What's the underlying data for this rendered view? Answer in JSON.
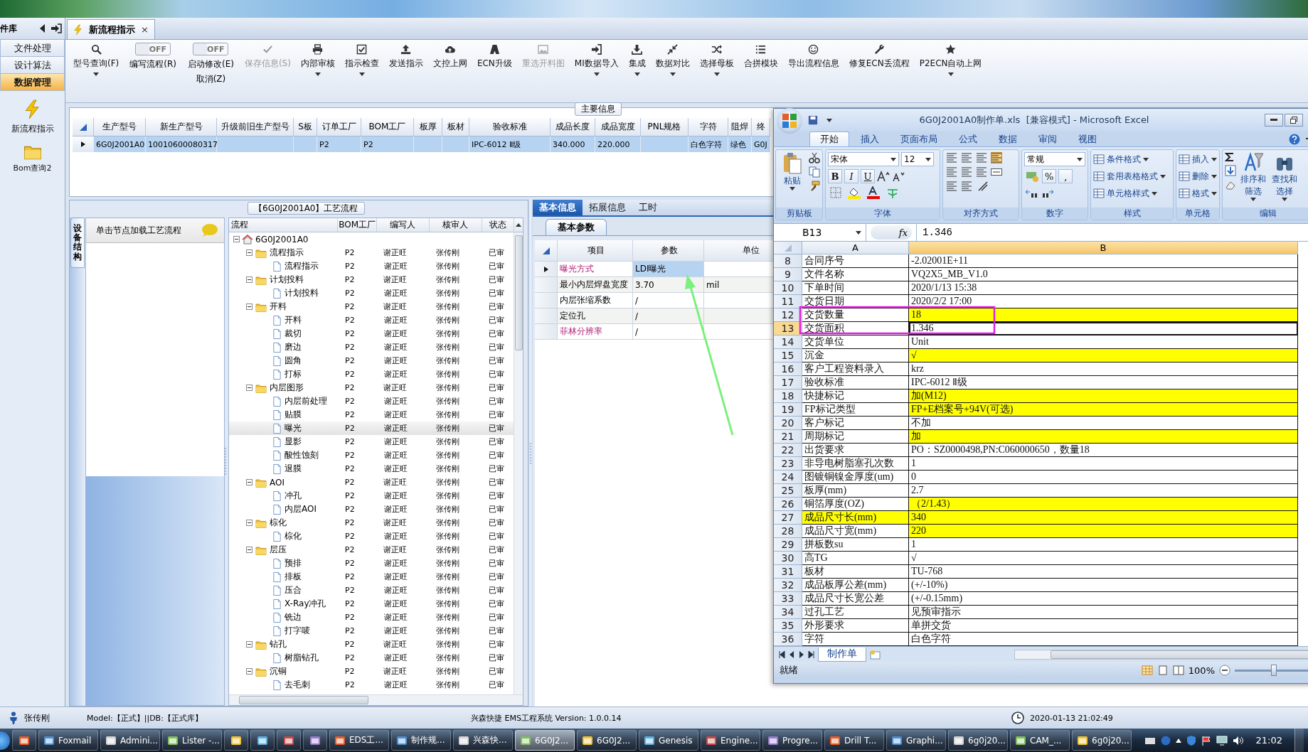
{
  "nav": {
    "title": "件库",
    "items": [
      {
        "label": "文件处理",
        "selected": false
      },
      {
        "label": "设计算法",
        "selected": false
      },
      {
        "label": "数据管理",
        "selected": true
      }
    ],
    "shortcuts": [
      {
        "kind": "bolt",
        "label": "新流程指示"
      },
      {
        "kind": "folder",
        "label": "Bom查询2"
      }
    ]
  },
  "document_tab": {
    "title": "新流程指示",
    "close": "×",
    "selected": true
  },
  "toolbar": [
    {
      "kind": "button",
      "label": "型号查询(F)",
      "disabled": false,
      "dropdown": true
    },
    {
      "kind": "toggle",
      "label": "编写流程(R)",
      "switch_text": "OFF",
      "on": false
    },
    {
      "kind": "toggle",
      "label": "启动修改(E)",
      "sublabel": "取消(Z)",
      "switch_text": "OFF",
      "on": false
    },
    {
      "kind": "button",
      "label": "保存信息(S)",
      "disabled": true,
      "dropdown": false
    },
    {
      "kind": "button",
      "label": "内部审核",
      "disabled": false,
      "dropdown": true
    },
    {
      "kind": "button",
      "label": "指示检查",
      "disabled": false,
      "dropdown": true
    },
    {
      "kind": "button",
      "label": "发送指示",
      "disabled": false,
      "dropdown": false
    },
    {
      "kind": "button",
      "label": "文控上网",
      "disabled": false,
      "dropdown": false
    },
    {
      "kind": "button",
      "label": "ECN升级",
      "disabled": false,
      "dropdown": false
    },
    {
      "kind": "button",
      "label": "重选开料图",
      "disabled": true,
      "dropdown": false
    },
    {
      "kind": "button",
      "label": "MI数据导入",
      "disabled": false,
      "dropdown": true
    },
    {
      "kind": "button",
      "label": "集成",
      "disabled": false,
      "dropdown": true
    },
    {
      "kind": "button",
      "label": "数据对比",
      "disabled": false,
      "dropdown": true
    },
    {
      "kind": "button",
      "label": "选择母板",
      "disabled": false,
      "dropdown": true
    },
    {
      "kind": "button",
      "label": "合拼模块",
      "disabled": false,
      "dropdown": false
    },
    {
      "kind": "button",
      "label": "导出流程信息",
      "disabled": false,
      "dropdown": false
    },
    {
      "kind": "button",
      "label": "修复ECN丢流程",
      "disabled": false,
      "dropdown": false
    },
    {
      "kind": "button",
      "label": "P2ECN自动上网",
      "disabled": false,
      "dropdown": true
    }
  ],
  "main_info": {
    "title": "主要信息",
    "columns": [
      "生产型号",
      "新生产型号",
      "升级前旧生产型号",
      "S板",
      "订单工厂",
      "BOM工厂",
      "板厚",
      "板材",
      "验收标准",
      "成品长度",
      "成品宽度",
      "PNL规格",
      "字符",
      "阻焊",
      "终"
    ],
    "rows": [
      {
        "selected": true,
        "cells": [
          "6G0J2001A0",
          "10010600080317",
          null,
          null,
          "P2",
          "P2",
          null,
          null,
          "IPC-6012 Ⅱ级",
          "340.000",
          "220.000",
          null,
          "白色字符",
          "绿色",
          "G0J"
        ]
      }
    ]
  },
  "process_panel": {
    "title": "【6G0J2001A0】工艺流程",
    "side_tab": "设备结构",
    "hint": "单击节点加载工艺流程",
    "columns": [
      "流程",
      "BOM工厂",
      "编写人",
      "核审人",
      "状态"
    ],
    "tree": [
      {
        "kind": "root",
        "name": "6G0J2001A0",
        "selected": false,
        "expanded": true,
        "children": [
          {
            "kind": "folder",
            "name": "流程指示",
            "bom": "P2",
            "writer": "谢正旺",
            "reviewer": "张传刚",
            "status": "已审",
            "selected": false,
            "expanded": true,
            "children": [
              {
                "kind": "step",
                "name": "流程指示",
                "bom": "P2",
                "writer": "谢正旺",
                "reviewer": "张传刚",
                "status": "已审",
                "selected": false
              }
            ]
          },
          {
            "kind": "folder",
            "name": "计划投料",
            "bom": "P2",
            "writer": "谢正旺",
            "reviewer": "张传刚",
            "status": "已审",
            "selected": false,
            "expanded": true,
            "children": [
              {
                "kind": "step",
                "name": "计划投料",
                "bom": "P2",
                "writer": "谢正旺",
                "reviewer": "张传刚",
                "status": "已审",
                "selected": false
              }
            ]
          },
          {
            "kind": "folder",
            "name": "开料",
            "bom": "P2",
            "writer": "谢正旺",
            "reviewer": "张传刚",
            "status": "已审",
            "selected": false,
            "expanded": true,
            "children": [
              {
                "kind": "step",
                "name": "开料",
                "bom": "P2",
                "writer": "谢正旺",
                "reviewer": "张传刚",
                "status": "已审",
                "selected": false
              },
              {
                "kind": "step",
                "name": "裁切",
                "bom": "P2",
                "writer": "谢正旺",
                "reviewer": "张传刚",
                "status": "已审",
                "selected": false
              },
              {
                "kind": "step",
                "name": "磨边",
                "bom": "P2",
                "writer": "谢正旺",
                "reviewer": "张传刚",
                "status": "已审",
                "selected": false
              },
              {
                "kind": "step",
                "name": "圆角",
                "bom": "P2",
                "writer": "谢正旺",
                "reviewer": "张传刚",
                "status": "已审",
                "selected": false
              },
              {
                "kind": "step",
                "name": "打标",
                "bom": "P2",
                "writer": "谢正旺",
                "reviewer": "张传刚",
                "status": "已审",
                "selected": false
              }
            ]
          },
          {
            "kind": "folder",
            "name": "内层图形",
            "bom": "P2",
            "writer": "谢正旺",
            "reviewer": "张传刚",
            "status": "已审",
            "selected": false,
            "expanded": true,
            "children": [
              {
                "kind": "step",
                "name": "内层前处理",
                "bom": "P2",
                "writer": "谢正旺",
                "reviewer": "张传刚",
                "status": "已审",
                "selected": false
              },
              {
                "kind": "step",
                "name": "贴膜",
                "bom": "P2",
                "writer": "谢正旺",
                "reviewer": "张传刚",
                "status": "已审",
                "selected": false
              },
              {
                "kind": "step",
                "name": "曝光",
                "bom": "P2",
                "writer": "谢正旺",
                "reviewer": "张传刚",
                "status": "已审",
                "selected": true
              },
              {
                "kind": "step",
                "name": "显影",
                "bom": "P2",
                "writer": "谢正旺",
                "reviewer": "张传刚",
                "status": "已审",
                "selected": false
              },
              {
                "kind": "step",
                "name": "酸性蚀刻",
                "bom": "P2",
                "writer": "谢正旺",
                "reviewer": "张传刚",
                "status": "已审",
                "selected": false
              },
              {
                "kind": "step",
                "name": "退膜",
                "bom": "P2",
                "writer": "谢正旺",
                "reviewer": "张传刚",
                "status": "已审",
                "selected": false
              }
            ]
          },
          {
            "kind": "folder",
            "name": "AOI",
            "bom": "P2",
            "writer": "谢正旺",
            "reviewer": "张传刚",
            "status": "已审",
            "selected": false,
            "expanded": true,
            "children": [
              {
                "kind": "step",
                "name": "冲孔",
                "bom": "P2",
                "writer": "谢正旺",
                "reviewer": "张传刚",
                "status": "已审",
                "selected": false
              },
              {
                "kind": "step",
                "name": "内层AOI",
                "bom": "P2",
                "writer": "谢正旺",
                "reviewer": "张传刚",
                "status": "已审",
                "selected": false
              }
            ]
          },
          {
            "kind": "folder",
            "name": "棕化",
            "bom": "P2",
            "writer": "谢正旺",
            "reviewer": "张传刚",
            "status": "已审",
            "selected": false,
            "expanded": true,
            "children": [
              {
                "kind": "step",
                "name": "棕化",
                "bom": "P2",
                "writer": "谢正旺",
                "reviewer": "张传刚",
                "status": "已审",
                "selected": false
              }
            ]
          },
          {
            "kind": "folder",
            "name": "层压",
            "bom": "P2",
            "writer": "谢正旺",
            "reviewer": "张传刚",
            "status": "已审",
            "selected": false,
            "expanded": true,
            "children": [
              {
                "kind": "step",
                "name": "预排",
                "bom": "P2",
                "writer": "谢正旺",
                "reviewer": "张传刚",
                "status": "已审",
                "selected": false
              },
              {
                "kind": "step",
                "name": "排板",
                "bom": "P2",
                "writer": "谢正旺",
                "reviewer": "张传刚",
                "status": "已审",
                "selected": false
              },
              {
                "kind": "step",
                "name": "压合",
                "bom": "P2",
                "writer": "谢正旺",
                "reviewer": "张传刚",
                "status": "已审",
                "selected": false
              },
              {
                "kind": "step",
                "name": "X-Ray冲孔",
                "bom": "P2",
                "writer": "谢正旺",
                "reviewer": "张传刚",
                "status": "已审",
                "selected": false
              },
              {
                "kind": "step",
                "name": "铣边",
                "bom": "P2",
                "writer": "谢正旺",
                "reviewer": "张传刚",
                "status": "已审",
                "selected": false
              },
              {
                "kind": "step",
                "name": "打字唛",
                "bom": "P2",
                "writer": "谢正旺",
                "reviewer": "张传刚",
                "status": "已审",
                "selected": false
              }
            ]
          },
          {
            "kind": "folder",
            "name": "钻孔",
            "bom": "P2",
            "writer": "谢正旺",
            "reviewer": "张传刚",
            "status": "已审",
            "selected": false,
            "expanded": true,
            "children": [
              {
                "kind": "step",
                "name": "树脂钻孔",
                "bom": "P2",
                "writer": "谢正旺",
                "reviewer": "张传刚",
                "status": "已审",
                "selected": false
              }
            ]
          },
          {
            "kind": "folder",
            "name": "沉铜",
            "bom": "P2",
            "writer": "谢正旺",
            "reviewer": "张传刚",
            "status": "已审",
            "selected": false,
            "expanded": true,
            "children": [
              {
                "kind": "step",
                "name": "去毛刺",
                "bom": "P2",
                "writer": "谢正旺",
                "reviewer": "张传刚",
                "status": "已审",
                "selected": false
              }
            ]
          }
        ]
      }
    ]
  },
  "basic_panel": {
    "tabs": [
      {
        "label": "基本信息",
        "selected": true
      },
      {
        "label": "拓展信息",
        "selected": false
      },
      {
        "label": "工时",
        "selected": false
      }
    ],
    "subtab": "基本参数",
    "columns": [
      "项目",
      "参数",
      "单位"
    ],
    "rows": [
      {
        "item": "曝光方式",
        "value": "LDI曝光",
        "emphasis": true,
        "selected": true
      },
      {
        "item": "最小内层焊盘宽度",
        "value": "3.70",
        "unit": "mil",
        "emphasis": false,
        "selected": false
      },
      {
        "item": "内层张缩系数",
        "value": "/",
        "emphasis": false,
        "selected": false
      },
      {
        "item": "定位孔",
        "value": "/",
        "emphasis": false,
        "selected": false
      },
      {
        "item": "菲林分辨率",
        "value": "/",
        "emphasis": true,
        "selected": false
      }
    ]
  },
  "excel": {
    "title": "6G0J2001A0制作单.xls  [兼容模式] - Microsoft Excel",
    "tabs": [
      {
        "label": "开始",
        "selected": true
      },
      {
        "label": "插入",
        "selected": false
      },
      {
        "label": "页面布局",
        "selected": false
      },
      {
        "label": "公式",
        "selected": false
      },
      {
        "label": "数据",
        "selected": false
      },
      {
        "label": "审阅",
        "selected": false
      },
      {
        "label": "视图",
        "selected": false
      }
    ],
    "ribbon": [
      {
        "kind": "clipboard",
        "label": "剪贴板",
        "paste": "粘贴"
      },
      {
        "kind": "font",
        "label": "字体",
        "font": "宋体",
        "size": "12",
        "styles": [
          "B",
          "I",
          "U"
        ]
      },
      {
        "kind": "align",
        "label": "对齐方式"
      },
      {
        "kind": "number",
        "label": "数字",
        "format": "常规",
        "symbols": [
          "%",
          ","
        ]
      },
      {
        "kind": "list",
        "label": "样式",
        "commands": [
          "条件格式",
          "套用表格格式",
          "单元格样式"
        ]
      },
      {
        "kind": "list",
        "label": "单元格",
        "commands": [
          "插入",
          "删除",
          "格式"
        ]
      },
      {
        "kind": "edit",
        "label": "编辑",
        "commands": [
          "排序和筛选",
          "查找和选择"
        ]
      }
    ],
    "name_box": "B13",
    "function_symbol": "fx",
    "formula": "1.346",
    "columns": [
      "A",
      "B"
    ],
    "rows": [
      {
        "n": "8",
        "a": "合同序号",
        "b": "-2.02001E+11",
        "highlight_a": false,
        "highlight_b": false,
        "active": false
      },
      {
        "n": "9",
        "a": "文件名称",
        "b": "VQ2X5_MB_V1.0",
        "highlight_a": false,
        "highlight_b": false,
        "active": false
      },
      {
        "n": "10",
        "a": "下单时间",
        "b": "2020/1/13 15:38",
        "highlight_a": false,
        "highlight_b": false,
        "active": false
      },
      {
        "n": "11",
        "a": "交货日期",
        "b": "2020/2/2 17:00",
        "highlight_a": false,
        "highlight_b": false,
        "active": false
      },
      {
        "n": "12",
        "a": "交货数量",
        "b": "18",
        "highlight_a": false,
        "highlight_b": true,
        "active": false
      },
      {
        "n": "13",
        "a": "交货面积",
        "b": "1.346",
        "highlight_a": false,
        "highlight_b": false,
        "active": true
      },
      {
        "n": "14",
        "a": "交货单位",
        "b": "Unit",
        "highlight_a": false,
        "highlight_b": false,
        "active": false
      },
      {
        "n": "15",
        "a": "沉金",
        "b": "√",
        "highlight_a": false,
        "highlight_b": true,
        "active": false
      },
      {
        "n": "16",
        "a": "客户工程资料录入",
        "b": "krz",
        "highlight_a": false,
        "highlight_b": false,
        "active": false
      },
      {
        "n": "17",
        "a": "验收标准",
        "b": "IPC-6012 Ⅱ级",
        "highlight_a": false,
        "highlight_b": false,
        "active": false
      },
      {
        "n": "18",
        "a": "快捷标记",
        "b": "加(M12)",
        "highlight_a": false,
        "highlight_b": true,
        "active": false
      },
      {
        "n": "19",
        "a": "FP标记类型",
        "b": "FP+E档案号+94V(可选)",
        "highlight_a": false,
        "highlight_b": true,
        "active": false
      },
      {
        "n": "20",
        "a": "客户标记",
        "b": "不加",
        "highlight_a": false,
        "highlight_b": false,
        "active": false
      },
      {
        "n": "21",
        "a": "周期标记",
        "b": "加",
        "highlight_a": false,
        "highlight_b": true,
        "active": false
      },
      {
        "n": "22",
        "a": "出货要求",
        "b": "PO：SZ0000498,PN:C060000650，数量18",
        "highlight_a": false,
        "highlight_b": false,
        "active": false
      },
      {
        "n": "23",
        "a": "非导电树脂塞孔次数",
        "b": "1",
        "highlight_a": false,
        "highlight_b": false,
        "active": false
      },
      {
        "n": "24",
        "a": "图镀铜镍金厚度(um)",
        "b": "0",
        "highlight_a": false,
        "highlight_b": false,
        "active": false
      },
      {
        "n": "25",
        "a": "板厚(mm)",
        "b": "2.7",
        "highlight_a": false,
        "highlight_b": false,
        "active": false
      },
      {
        "n": "26",
        "a": "铜箔厚度(OZ)",
        "b": "（2/1.43）",
        "highlight_a": false,
        "highlight_b": true,
        "active": false
      },
      {
        "n": "27",
        "a": "成品尺寸长(mm)",
        "b": "340",
        "highlight_a": true,
        "highlight_b": true,
        "active": false
      },
      {
        "n": "28",
        "a": "成品尺寸宽(mm)",
        "b": "220",
        "highlight_a": false,
        "highlight_b": true,
        "active": false
      },
      {
        "n": "29",
        "a": "拼板数su",
        "b": "1",
        "highlight_a": false,
        "highlight_b": false,
        "active": false
      },
      {
        "n": "30",
        "a": "高TG",
        "b": "√",
        "highlight_a": false,
        "highlight_b": false,
        "active": false
      },
      {
        "n": "31",
        "a": "板材",
        "b": "TU-768",
        "highlight_a": false,
        "highlight_b": false,
        "active": false
      },
      {
        "n": "32",
        "a": "成品板厚公差(mm)",
        "b": "(+/-10%)",
        "highlight_a": false,
        "highlight_b": false,
        "active": false
      },
      {
        "n": "33",
        "a": "成品尺寸长宽公差",
        "b": "(+/-0.15mm)",
        "highlight_a": false,
        "highlight_b": false,
        "active": false
      },
      {
        "n": "34",
        "a": "过孔工艺",
        "b": "见预审指示",
        "highlight_a": false,
        "highlight_b": false,
        "active": false
      },
      {
        "n": "35",
        "a": "外形要求",
        "b": "单拼交货",
        "highlight_a": false,
        "highlight_b": false,
        "active": false
      },
      {
        "n": "36",
        "a": "字符",
        "b": "白色字符",
        "highlight_a": false,
        "highlight_b": false,
        "active": false
      }
    ],
    "sheet_tab": "制作单",
    "status": "就绪",
    "zoom": "100%",
    "zoom_slider": {
      "level": 0.5
    }
  },
  "status_bar": {
    "user": "张传刚",
    "model": "Model:【正式】||DB:【正式库】",
    "app": "兴森快捷 EMS工程系统 Version: 1.0.0.14",
    "datetime": "2020-01-13 21:02:49"
  },
  "taskbar": {
    "items": [
      {
        "kind": "icon",
        "selected": false
      },
      {
        "kind": "app",
        "label": "Foxmail",
        "selected": false
      },
      {
        "kind": "app",
        "label": "Admini...",
        "selected": false
      },
      {
        "kind": "app",
        "label": "Lister -...",
        "selected": false
      },
      {
        "kind": "icon",
        "selected": false
      },
      {
        "kind": "icon",
        "selected": false
      },
      {
        "kind": "icon",
        "selected": false
      },
      {
        "kind": "icon",
        "selected": false
      },
      {
        "kind": "app",
        "label": "EDS工...",
        "selected": false
      },
      {
        "kind": "app",
        "label": "制作规...",
        "selected": false
      },
      {
        "kind": "app",
        "label": "兴森快...",
        "selected": false
      },
      {
        "kind": "app",
        "label": "6G0J2...",
        "selected": true
      },
      {
        "kind": "app",
        "label": "6G0J2...",
        "selected": false
      },
      {
        "kind": "app",
        "label": "Genesis",
        "selected": false
      },
      {
        "kind": "app",
        "label": "Engine...",
        "selected": false
      },
      {
        "kind": "app",
        "label": "Progre...",
        "selected": false
      },
      {
        "kind": "app",
        "label": "Drill T...",
        "selected": false
      },
      {
        "kind": "app",
        "label": "Graphi...",
        "selected": false
      },
      {
        "kind": "app",
        "label": "6g0j20...",
        "selected": false
      },
      {
        "kind": "app",
        "label": "CAM_...",
        "selected": false
      },
      {
        "kind": "app",
        "label": "6g0j20...",
        "selected": false
      }
    ],
    "clock": "21:02"
  }
}
